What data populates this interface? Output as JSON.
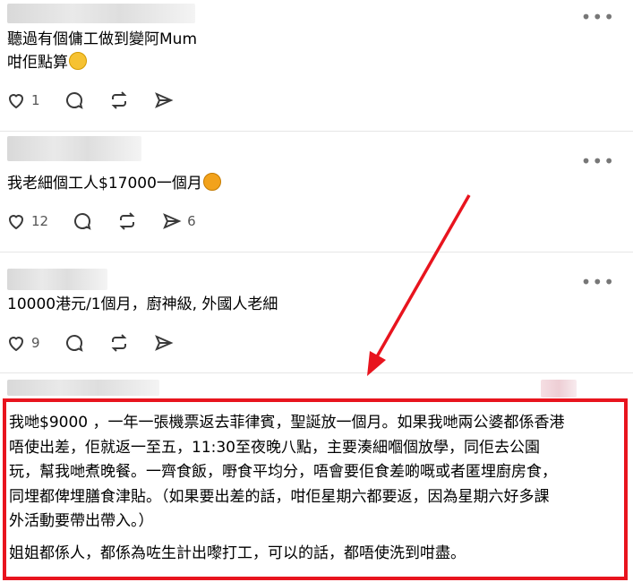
{
  "posts": [
    {
      "lines": [
        "聽過有個傭工做到變阿Mum",
        "咁佢點算"
      ],
      "emoji": "grinning-sweat-emoji",
      "likes": "1",
      "reposts": "",
      "shares": ""
    },
    {
      "lines": [
        "我老細個工人$17000一個月"
      ],
      "emoji": "weary-cat-emoji",
      "likes": "12",
      "reposts": "",
      "shares": "6"
    },
    {
      "lines": [
        "10000港元/1個月，廚神級, 外國人老細"
      ],
      "likes": "9",
      "reposts": "",
      "shares": ""
    }
  ],
  "reply": {
    "lines": [
      "我哋$9000 ，一年一張機票返去菲律賓，聖誕放一個月。如果我哋兩公婆都係香港",
      "唔使出差，佢就返一至五，11:30至夜晚八點，主要湊細嗰個放學，同佢去公園",
      "玩，幫我哋煮晚餐。一齊食飯，嘢食平均分，唔會要佢食差啲嘅或者匿埋廚房食，",
      "同埋都俾埋膳食津貼。（如果要出差的話，咁佢星期六都要返，因為星期六好多課",
      "外活動要帶出帶入。）"
    ],
    "closing": "姐姐都係人，都係為咗生計出嚟打工，可以的話，都唔使洗到咁盡。"
  },
  "colors": {
    "highlight": "#e8141e",
    "arrow": "#e8141e",
    "text": "#000000",
    "icon": "#3a3a3a"
  },
  "icons": [
    "heart-icon",
    "comment-icon",
    "repost-icon",
    "share-icon",
    "more-options-icon"
  ]
}
